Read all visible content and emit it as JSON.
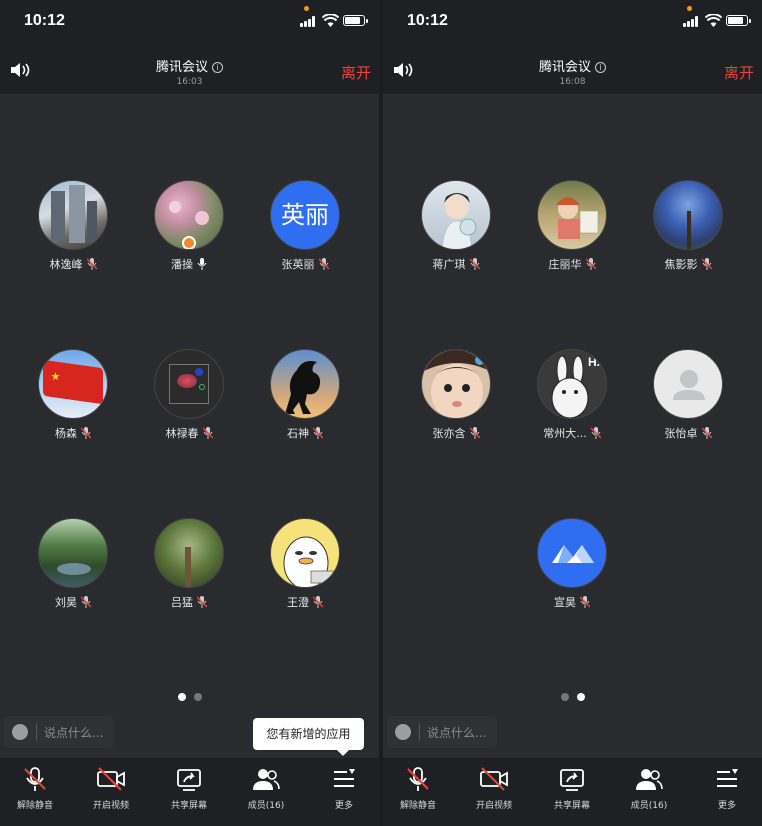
{
  "left": {
    "status_time": "10:12",
    "title": "腾讯会议",
    "meeting_time": "16:03",
    "leave_label": "离开",
    "participants": [
      {
        "name": "林逸峰",
        "mic": "muted",
        "avatar": "buildings-photo"
      },
      {
        "name": "潘操",
        "mic": "on",
        "avatar": "flowers-photo"
      },
      {
        "name": "张英丽",
        "mic": "muted",
        "avatar_text": "英丽"
      },
      {
        "name": "杨森",
        "mic": "muted",
        "avatar": "flag-photo"
      },
      {
        "name": "林禄春",
        "mic": "muted",
        "avatar": "scatter-plot-photo"
      },
      {
        "name": "石神",
        "mic": "muted",
        "avatar": "horse-silhouette-photo"
      },
      {
        "name": "刘昊",
        "mic": "muted",
        "avatar": "forest-river-photo"
      },
      {
        "name": "吕猛",
        "mic": "muted",
        "avatar": "trees-photo"
      },
      {
        "name": "王澄",
        "mic": "muted",
        "avatar": "cartoon-duck"
      }
    ],
    "page_indicator": {
      "active": 1,
      "total": 2
    },
    "chat_placeholder": "说点什么...",
    "tooltip": "您有新增的应用"
  },
  "right": {
    "status_time": "10:12",
    "title": "腾讯会议",
    "meeting_time": "16:08",
    "leave_label": "离开",
    "participants": [
      {
        "name": "蒋广琪",
        "mic": "muted",
        "avatar": "anime-girl"
      },
      {
        "name": "庄丽华",
        "mic": "muted",
        "avatar": "cartoon-girl-painting"
      },
      {
        "name": "焦影影",
        "mic": "muted",
        "avatar": "blue-tree-photo"
      },
      {
        "name": "张亦含",
        "mic": "muted",
        "avatar": "child-photo"
      },
      {
        "name": "常州大...",
        "mic": "muted",
        "avatar": "rabbit-cartoon"
      },
      {
        "name": "张怡卓",
        "mic": "muted",
        "avatar": "default-person"
      },
      {
        "name": "宣昊",
        "mic": "muted",
        "avatar": "tencent-meeting-logo"
      }
    ],
    "page_indicator": {
      "active": 2,
      "total": 2
    },
    "chat_placeholder": "说点什么..."
  },
  "toolbar": {
    "unmute": "解除静音",
    "video": "开启视频",
    "share": "共享屏幕",
    "members": "成员(16)",
    "more": "更多"
  },
  "colors": {
    "leave": "#e8453c",
    "accent": "#2f6ef0",
    "bg": "#2a2b2f",
    "bar": "#1f2023"
  }
}
